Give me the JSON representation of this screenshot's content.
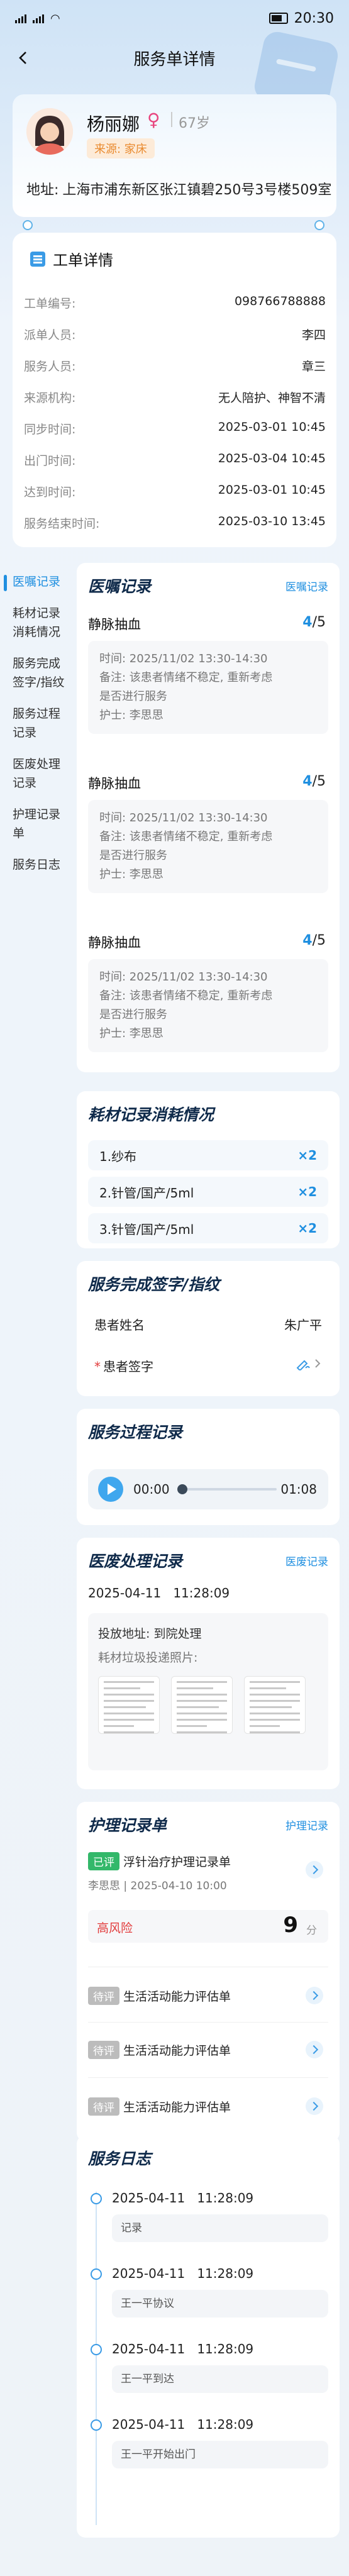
{
  "status_bar": {
    "signal": "ıll ıll",
    "time": "20:30"
  },
  "nav": {
    "title": "服务单详情"
  },
  "patient": {
    "name": "杨丽娜",
    "gender_symbol": "♀",
    "age": "67岁",
    "source_badge": "来源: 家床",
    "address_label": "地址:",
    "address": "上海市浦东新区张江镇碧250号3号楼509室"
  },
  "work_order": {
    "title": "工单详情",
    "rows": [
      {
        "label": "工单编号:",
        "value": "098766788888"
      },
      {
        "label": "派单人员:",
        "value": "李四"
      },
      {
        "label": "服务人员:",
        "value": "章三"
      },
      {
        "label": "来源机构:",
        "value": "无人陪护、神智不清"
      },
      {
        "label": "同步时间:",
        "value": "2025-03-01 10:45"
      },
      {
        "label": "出门时间:",
        "value": "2025-03-04 10:45"
      },
      {
        "label": "达到时间:",
        "value": "2025-03-01 10:45"
      },
      {
        "label": "服务结束时间:",
        "value": "2025-03-10 13:45"
      }
    ]
  },
  "sidebar": {
    "items": [
      {
        "label": "医嘱记录"
      },
      {
        "label": "耗材记录消耗情况"
      },
      {
        "label": "服务完成签字/指纹"
      },
      {
        "label": "服务过程记录"
      },
      {
        "label": "医废处理记录"
      },
      {
        "label": "护理记录单"
      },
      {
        "label": "服务日志"
      }
    ]
  },
  "orders": {
    "title": "医嘱记录",
    "link": "医嘱记录",
    "items": [
      {
        "name": "静脉抽血",
        "done": "4",
        "total": "/5",
        "time": "时间:  2025/11/02 13:30-14:30",
        "note_line1": "备注:  该患者情绪不稳定, 重新考虑",
        "note_line2": "是否进行服务",
        "nurse": "护士:  李思思"
      },
      {
        "name": "静脉抽血",
        "done": "4",
        "total": "/5",
        "time": "时间:  2025/11/02 13:30-14:30",
        "note_line1": "备注:  该患者情绪不稳定, 重新考虑",
        "note_line2": "是否进行服务",
        "nurse": "护士:  李思思"
      },
      {
        "name": "静脉抽血",
        "done": "4",
        "total": "/5",
        "time": "时间:  2025/11/02 13:30-14:30",
        "note_line1": "备注:  该患者情绪不稳定, 重新考虑",
        "note_line2": "是否进行服务",
        "nurse": "护士:  李思思"
      }
    ]
  },
  "materials": {
    "title": "耗材记录消耗情况",
    "items": [
      {
        "name": "1.纱布",
        "qty": "×2"
      },
      {
        "name": "2.针管/国产/5ml",
        "qty": "×2"
      },
      {
        "name": "3.针管/国产/5ml",
        "qty": "×2"
      }
    ]
  },
  "signature": {
    "title": "服务完成签字/指纹",
    "patient_name_label": "患者姓名",
    "patient_name": "朱广平",
    "sign_label": "患者签字"
  },
  "process": {
    "title": "服务过程记录",
    "time_current": "00:00",
    "time_total": "01:08"
  },
  "waste": {
    "title": "医废处理记录",
    "link": "医废记录",
    "date": "2025-04-11",
    "time": "11:28:09",
    "location": "投放地址:  到院处理",
    "photos_label": "耗材垃圾投递照片:"
  },
  "care": {
    "title": "护理记录单",
    "link": "护理记录",
    "main": {
      "tag": "已评",
      "name": "浮针治疗护理记录单",
      "meta": "李思思  |  2025-04-10 10:00",
      "risk": "高风险",
      "score": "9",
      "unit": "分"
    },
    "pending": [
      {
        "tag": "待评",
        "name": "生活活动能力评估单"
      },
      {
        "tag": "待评",
        "name": "生活活动能力评估单"
      },
      {
        "tag": "待评",
        "name": "生活活动能力评估单"
      }
    ]
  },
  "log": {
    "title": "服务日志",
    "items": [
      {
        "date": "2025-04-11",
        "time": "11:28:09",
        "note": "记录"
      },
      {
        "date": "2025-04-11",
        "time": "11:28:09",
        "note": "王一平协议"
      },
      {
        "date": "2025-04-11",
        "time": "11:28:09",
        "note": "王一平到达"
      },
      {
        "date": "2025-04-11",
        "time": "11:28:09",
        "note": "王一平开始出门"
      }
    ]
  },
  "colors": {
    "accent": "#1f8fe0",
    "risk": "#e23b3b",
    "done_tag": "#33b86a",
    "pending_tag": "#bcbcbc"
  }
}
